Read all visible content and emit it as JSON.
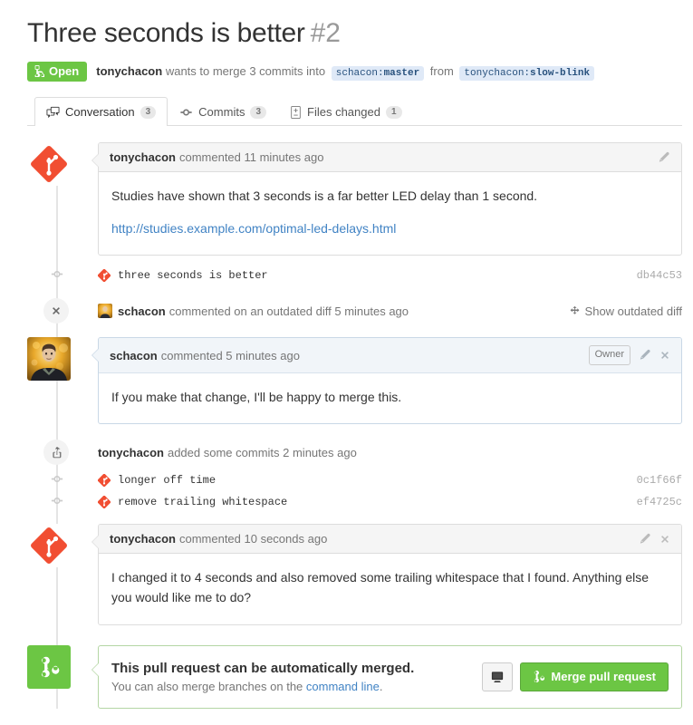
{
  "header": {
    "title": "Three seconds is better",
    "number": "#2",
    "state": "Open",
    "author": "tonychacon",
    "merge_text_1": "wants to merge 3 commits into",
    "base_branch_owner": "schacon:",
    "base_branch_name": "master",
    "merge_text_2": "from",
    "head_branch_owner": "tonychacon:",
    "head_branch_name": "slow-blink"
  },
  "tabs": [
    {
      "label": "Conversation",
      "count": "3",
      "icon": "comment-discussion-icon",
      "active": true
    },
    {
      "label": "Commits",
      "count": "3",
      "icon": "git-commit-icon",
      "active": false
    },
    {
      "label": "Files changed",
      "count": "1",
      "icon": "file-diff-icon",
      "active": false
    }
  ],
  "timeline": [
    {
      "kind": "comment",
      "avatar": "git-logo-avatar",
      "author": "tonychacon",
      "meta": "commented 11 minutes ago",
      "owner": false,
      "owner_badge": null,
      "actions": [
        "pencil-icon"
      ],
      "body": [
        {
          "type": "text",
          "text": "Studies have shown that 3 seconds is a far better LED delay than 1 second."
        },
        {
          "type": "link",
          "text": "http://studies.example.com/optimal-led-delays.html"
        }
      ]
    },
    {
      "kind": "commits",
      "rows": [
        {
          "message": "three seconds is better",
          "sha": "db44c53"
        }
      ]
    },
    {
      "kind": "event",
      "badge": "x-icon",
      "avatar": "schacon-photo-avatar",
      "author": "schacon",
      "meta": "commented on an outdated diff 5 minutes ago",
      "right_label": "Show outdated diff",
      "right_icon": "unfold-diff-icon"
    },
    {
      "kind": "comment",
      "avatar": "schacon-photo-avatar",
      "author": "schacon",
      "meta": "commented 5 minutes ago",
      "owner": true,
      "owner_badge": "Owner",
      "actions": [
        "pencil-icon",
        "close-icon"
      ],
      "body": [
        {
          "type": "text",
          "text": "If you make that change, I'll be happy to merge this."
        }
      ]
    },
    {
      "kind": "event",
      "badge": "repo-push-icon",
      "avatar": null,
      "author": "tonychacon",
      "meta": "added some commits 2 minutes ago",
      "right_label": null,
      "right_icon": null
    },
    {
      "kind": "commits",
      "rows": [
        {
          "message": "longer off time",
          "sha": "0c1f66f"
        },
        {
          "message": "remove trailing whitespace",
          "sha": "ef4725c"
        }
      ]
    },
    {
      "kind": "comment",
      "avatar": "git-logo-avatar",
      "author": "tonychacon",
      "meta": "commented 10 seconds ago",
      "owner": false,
      "owner_badge": null,
      "actions": [
        "pencil-icon",
        "close-icon"
      ],
      "body": [
        {
          "type": "text",
          "text": "I changed it to 4 seconds and also removed some trailing whitespace that I found. Anything else you would like me to do?"
        }
      ]
    }
  ],
  "merge": {
    "icon": "git-merge-icon",
    "title": "This pull request can be automatically merged.",
    "sub_prefix": "You can also merge branches on the ",
    "sub_link": "command line",
    "sub_suffix": ".",
    "command_line_button_icon": "terminal-icon",
    "merge_button_label": "Merge pull request",
    "merge_button_icon": "git-merge-icon"
  },
  "colors": {
    "green": "#6cc644",
    "link": "#4183c4",
    "git_orange": "#f14e32",
    "branch_bg": "#dfe9f7",
    "branch_text": "#28517d"
  }
}
